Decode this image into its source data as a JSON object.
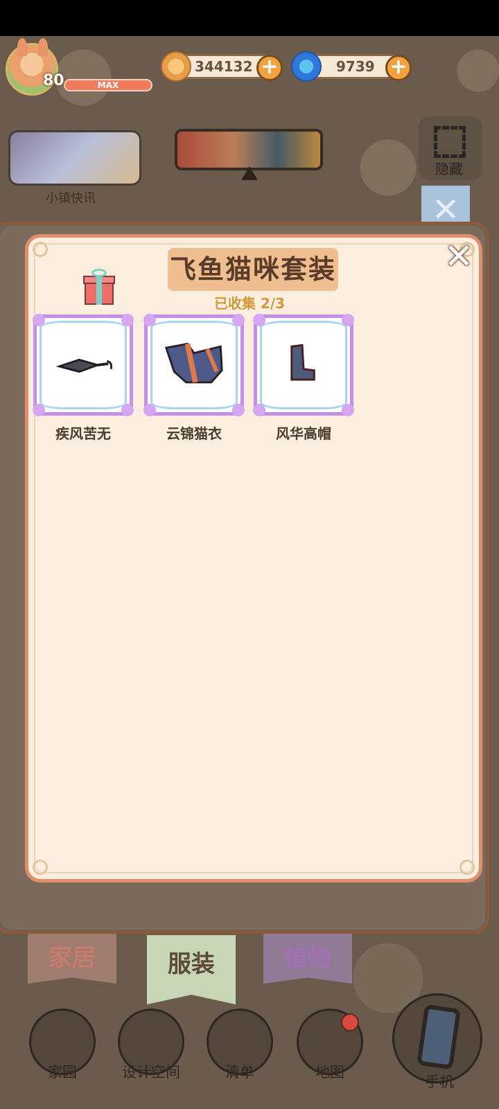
{
  "hud": {
    "level": "80",
    "xp_label": "MAX",
    "coins": "344132",
    "gems": "9739",
    "coin_icon": "coin-icon",
    "gem_icon": "blue-swirl-icon"
  },
  "top": {
    "news_label": "小镇快讯",
    "hide_label": "隐藏"
  },
  "panel": {
    "title": "飞鱼猫咪套装",
    "progress": "已收集 2/3",
    "items": [
      {
        "name": "疾风苦无"
      },
      {
        "name": "云锦猫衣"
      },
      {
        "name": "风华高帽"
      }
    ]
  },
  "tabs": [
    {
      "label": "家居"
    },
    {
      "label": "服装"
    },
    {
      "label": "植物"
    }
  ],
  "nav": [
    {
      "label": "家园"
    },
    {
      "label": "设计空间"
    },
    {
      "label": "清单"
    },
    {
      "label": "地图"
    },
    {
      "label": "手机"
    }
  ],
  "colors": {
    "panel_bg": "#fbeede",
    "panel_border": "#e08f6a",
    "title_bg": "#efbf8f",
    "progress_text": "#d29a3a",
    "item_frame": "#c58ee8"
  }
}
